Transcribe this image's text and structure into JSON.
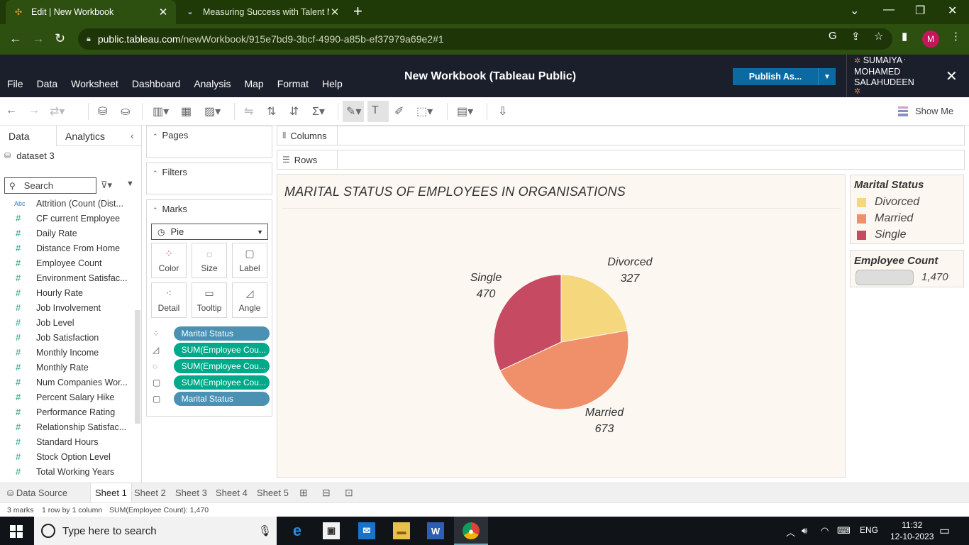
{
  "browser": {
    "tabs": [
      {
        "title": "Edit | New Workbook",
        "close": "✕"
      },
      {
        "title": "Measuring Success with Talent M",
        "close": "✕"
      }
    ],
    "new_tab": "+",
    "url_host": "public.tableau.com",
    "url_path": "/newWorkbook/915e7bd9-3bcf-4990-a85b-ef37979a69e2#1",
    "profile_initial": "M"
  },
  "header": {
    "menu": [
      "File",
      "Data",
      "Worksheet",
      "Dashboard",
      "Analysis",
      "Map",
      "Format",
      "Help"
    ],
    "workbook_title": "New Workbook (Tableau Public)",
    "publish_label": "Publish As...",
    "user_name_line1": "SUMAIYA",
    "user_name_line2": "MOHAMED",
    "user_name_line3": "SALAHUDEEN"
  },
  "toolbar": {
    "show_me": "Show Me"
  },
  "data_pane": {
    "tab_data": "Data",
    "tab_analytics": "Analytics",
    "dataset": "dataset 3",
    "search_placeholder": "Search",
    "fields": [
      {
        "type": "Abc",
        "name": "Attrition (Count (Dist..."
      },
      {
        "type": "#",
        "name": "CF current Employee"
      },
      {
        "type": "#",
        "name": "Daily Rate"
      },
      {
        "type": "#",
        "name": "Distance From Home"
      },
      {
        "type": "#",
        "name": "Employee Count"
      },
      {
        "type": "#",
        "name": "Environment Satisfac..."
      },
      {
        "type": "#",
        "name": "Hourly Rate"
      },
      {
        "type": "#",
        "name": "Job Involvement"
      },
      {
        "type": "#",
        "name": "Job Level"
      },
      {
        "type": "#",
        "name": "Job Satisfaction"
      },
      {
        "type": "#",
        "name": "Monthly Income"
      },
      {
        "type": "#",
        "name": "Monthly Rate"
      },
      {
        "type": "#",
        "name": "Num Companies Wor..."
      },
      {
        "type": "#",
        "name": "Percent Salary Hike"
      },
      {
        "type": "#",
        "name": "Performance Rating"
      },
      {
        "type": "#",
        "name": "Relationship Satisfac..."
      },
      {
        "type": "#",
        "name": "Standard Hours"
      },
      {
        "type": "#",
        "name": "Stock Option Level"
      },
      {
        "type": "#",
        "name": "Total Working Years"
      }
    ]
  },
  "cards": {
    "pages": "Pages",
    "filters": "Filters",
    "marks": "Marks",
    "mark_type": "Pie",
    "mark_buttons": [
      "Color",
      "Size",
      "Label",
      "Detail",
      "Tooltip",
      "Angle"
    ],
    "mark_pills": [
      {
        "label": "Marital Status",
        "kind": "blue"
      },
      {
        "label": "SUM(Employee Cou...",
        "kind": "green"
      },
      {
        "label": "SUM(Employee Cou...",
        "kind": "green"
      },
      {
        "label": "SUM(Employee Cou...",
        "kind": "green"
      },
      {
        "label": "Marital Status",
        "kind": "blue"
      }
    ]
  },
  "shelves": {
    "columns": "Columns",
    "rows": "Rows"
  },
  "chart_data": {
    "type": "pie",
    "title": "MARITAL STATUS OF EMPLOYEES IN ORGANISATIONS",
    "categories": [
      "Divorced",
      "Married",
      "Single"
    ],
    "values": [
      327,
      673,
      470
    ],
    "colors": [
      "#f5d77e",
      "#f0906a",
      "#c54a62"
    ],
    "legend_title": "Marital Status",
    "legend_position": "right"
  },
  "size_legend": {
    "title": "Employee Count",
    "value": "1,470"
  },
  "sheets": {
    "data_source": "Data Source",
    "tabs": [
      "Sheet 1",
      "Sheet 2",
      "Sheet 3",
      "Sheet 4",
      "Sheet 5"
    ],
    "active": "Sheet 1"
  },
  "status": {
    "marks": "3 marks",
    "dims": "1 row by 1 column",
    "sum": "SUM(Employee Count): 1,470"
  },
  "taskbar": {
    "search_placeholder": "Type here to search",
    "lang": "ENG",
    "time": "11:32",
    "date": "12-10-2023"
  }
}
